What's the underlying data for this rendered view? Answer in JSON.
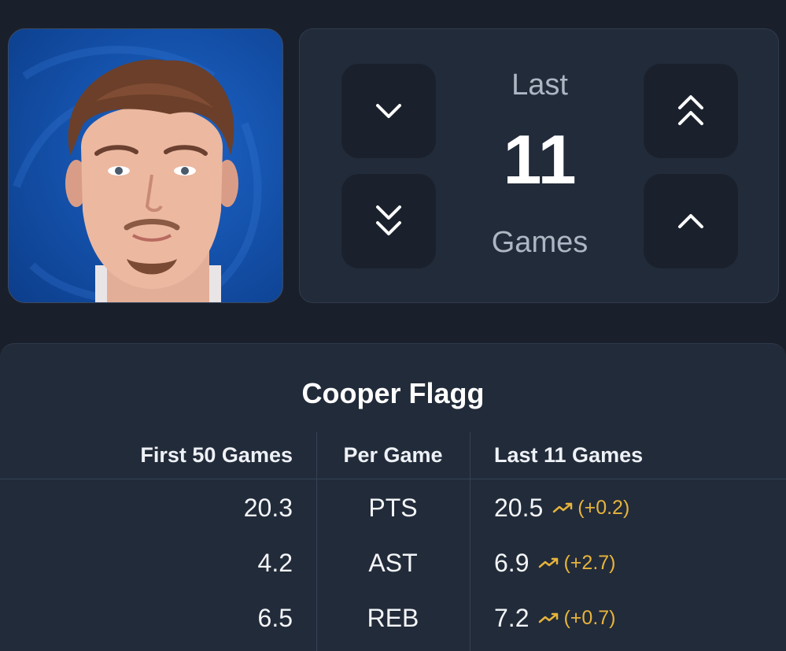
{
  "selector": {
    "label_top": "Last",
    "count": "11",
    "label_bottom": "Games",
    "buttons": {
      "decrease_one": "chevron-down-icon",
      "decrease_many": "double-chevron-down-icon",
      "increase_many": "double-chevron-up-icon",
      "increase_one": "chevron-up-icon"
    }
  },
  "player": {
    "name": "Cooper Flagg"
  },
  "table": {
    "headers": {
      "first": "First 50 Games",
      "per": "Per Game",
      "last": "Last 11 Games"
    },
    "rows": [
      {
        "first": "20.3",
        "stat": "PTS",
        "last": "20.5",
        "change": "(+0.2)"
      },
      {
        "first": "4.2",
        "stat": "AST",
        "last": "6.9",
        "change": "(+2.7)"
      },
      {
        "first": "6.5",
        "stat": "REB",
        "last": "7.2",
        "change": "(+0.7)"
      }
    ]
  },
  "colors": {
    "background": "#1a202b",
    "card": "#222b39",
    "button": "#1a212d",
    "trend_up": "#e6b43c",
    "photo_bg": "#1553ad"
  }
}
